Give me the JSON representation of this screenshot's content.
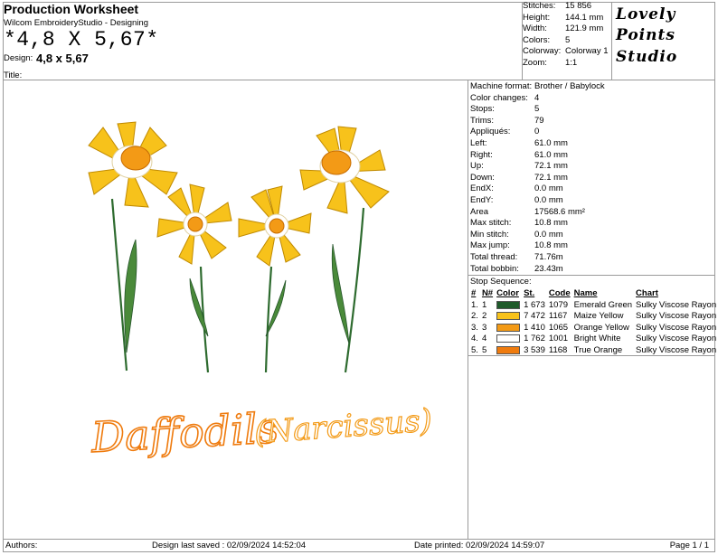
{
  "header": {
    "title": "Production Worksheet",
    "app": "Wilcom EmbroideryStudio - Designing",
    "design_big": "*4,8 X 5,67*",
    "design_label": "Design:",
    "design_value": "4,8 x 5,67",
    "title_label": "Title:"
  },
  "stats": [
    {
      "k": "Stitches:",
      "v": "15 856"
    },
    {
      "k": "Height:",
      "v": "144.1 mm"
    },
    {
      "k": "Width:",
      "v": "121.9 mm"
    },
    {
      "k": "Colors:",
      "v": "5"
    },
    {
      "k": "Colorway:",
      "v": "Colorway 1"
    },
    {
      "k": "Zoom:",
      "v": "1:1"
    }
  ],
  "logo": {
    "line1": "Lovely",
    "line2": "Points",
    "line3": "Studio"
  },
  "details": [
    {
      "k": "Machine format:",
      "v": "Brother / Babylock"
    },
    {
      "k": "Color changes:",
      "v": "4"
    },
    {
      "k": "Stops:",
      "v": "5"
    },
    {
      "k": "Trims:",
      "v": "79"
    },
    {
      "k": "Appliqués:",
      "v": "0"
    },
    {
      "k": "Left:",
      "v": "61.0 mm"
    },
    {
      "k": "Right:",
      "v": "61.0 mm"
    },
    {
      "k": "Up:",
      "v": "72.1 mm"
    },
    {
      "k": "Down:",
      "v": "72.1 mm"
    },
    {
      "k": "EndX:",
      "v": "0.0 mm"
    },
    {
      "k": "EndY:",
      "v": "0.0 mm"
    },
    {
      "k": "Area",
      "v": "17568.6 mm²"
    },
    {
      "k": "Max stitch:",
      "v": "10.8 mm"
    },
    {
      "k": "Min stitch:",
      "v": "0.0 mm"
    },
    {
      "k": "Max jump:",
      "v": "10.8 mm"
    },
    {
      "k": "Total thread:",
      "v": "71.76m"
    },
    {
      "k": "Total bobbin:",
      "v": "23.43m"
    }
  ],
  "stops": {
    "title": "Stop Sequence:",
    "headers": {
      "num": "#",
      "n": "N#",
      "color": "Color",
      "st": "St.",
      "code": "Code",
      "name": "Name",
      "chart": "Chart"
    },
    "rows": [
      {
        "num": "1.",
        "n": "1",
        "color": "#1f5a2a",
        "st": "1 673",
        "code": "1079",
        "name": "Emerald Green",
        "chart": "Sulky Viscose Rayon"
      },
      {
        "num": "2.",
        "n": "2",
        "color": "#f7c21b",
        "st": "7 472",
        "code": "1167",
        "name": "Maize Yellow",
        "chart": "Sulky Viscose Rayon"
      },
      {
        "num": "3.",
        "n": "3",
        "color": "#f39a16",
        "st": "1 410",
        "code": "1065",
        "name": "Orange Yellow",
        "chart": "Sulky Viscose Rayon"
      },
      {
        "num": "4.",
        "n": "4",
        "color": "#ffffff",
        "st": "1 762",
        "code": "1001",
        "name": "Bright White",
        "chart": "Sulky Viscose Rayon"
      },
      {
        "num": "5.",
        "n": "5",
        "color": "#ef7b0e",
        "st": "3 539",
        "code": "1168",
        "name": "True Orange",
        "chart": "Sulky Viscose Rayon"
      }
    ]
  },
  "design_text": {
    "word1": "Daffodils",
    "word2": "(Narcissus)"
  },
  "footer": {
    "authors": "Authors:",
    "saved": "Design last saved : 02/09/2024 14:52:04",
    "printed": "Date printed: 02/09/2024 14:59:07",
    "page": "Page 1 / 1"
  }
}
